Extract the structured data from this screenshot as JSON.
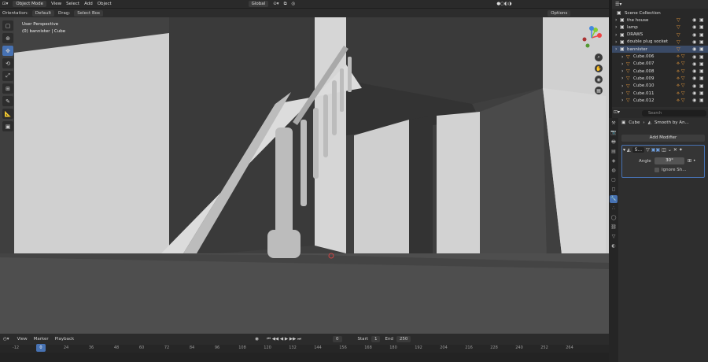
{
  "header": {
    "mode": "Object Mode",
    "menus": [
      "View",
      "Select",
      "Add",
      "Object"
    ],
    "orientation_label": "Orientation:",
    "orientation_value": "Default",
    "drag_label": "Drag:",
    "drag_value": "Select Box",
    "transform_space": "Global",
    "options": "Options"
  },
  "viewport": {
    "perspective": "User Perspective",
    "active": "(0) bannister | Cube"
  },
  "timeline": {
    "menus": [
      "View",
      "Marker",
      "Playback"
    ],
    "current_frame": "0",
    "start_label": "Start",
    "start": "1",
    "end_label": "End",
    "end": "250",
    "cursor": "0",
    "ticks": [
      "-12",
      "12",
      "24",
      "36",
      "48",
      "60",
      "72",
      "84",
      "96",
      "108",
      "120",
      "132",
      "144",
      "156",
      "168",
      "180",
      "192",
      "204",
      "216",
      "228",
      "240",
      "252",
      "264"
    ]
  },
  "outliner": {
    "root": "Scene Collection",
    "items": [
      {
        "name": "the house",
        "depth": 0
      },
      {
        "name": "lamp",
        "depth": 0
      },
      {
        "name": "DRAWS",
        "depth": 0
      },
      {
        "name": "double plug socket",
        "depth": 0
      },
      {
        "name": "bannister",
        "depth": 0
      },
      {
        "name": "Cube.006",
        "depth": 1
      },
      {
        "name": "Cube.007",
        "depth": 1
      },
      {
        "name": "Cube.008",
        "depth": 1
      },
      {
        "name": "Cube.009",
        "depth": 1
      },
      {
        "name": "Cube.010",
        "depth": 1
      },
      {
        "name": "Cube.011",
        "depth": 1
      },
      {
        "name": "Cube.012",
        "depth": 1
      }
    ]
  },
  "properties": {
    "search_placeholder": "Search",
    "crumb_object": "Cube",
    "crumb_modifier": "Smooth by An...",
    "add_modifier": "Add Modifier",
    "modifier_short": "S...",
    "angle_label": "Angle",
    "angle_value": "30°",
    "ignore_label": "Ignore Sh..."
  },
  "colors": {
    "accent": "#4772b3",
    "orange": "#e89a3c"
  }
}
